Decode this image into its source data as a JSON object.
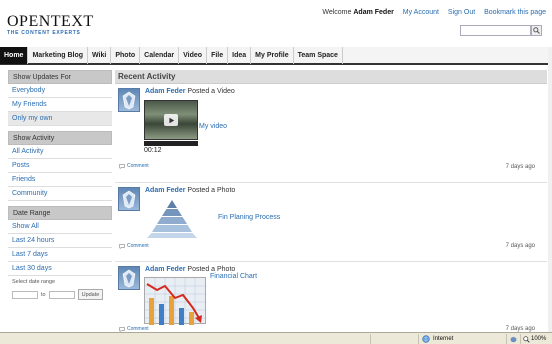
{
  "header": {
    "logo_name": "OPENTEXT",
    "logo_tagline": "THE CONTENT EXPERTS",
    "welcome_prefix": "Welcome",
    "user_name": "Adam Feder",
    "links": [
      "My Account",
      "Sign Out",
      "Bookmark this page"
    ]
  },
  "nav": {
    "tabs": [
      "Home",
      "Marketing Blog",
      "Wiki",
      "Photo",
      "Calendar",
      "Video",
      "File",
      "Idea",
      "My Profile",
      "Team Space"
    ],
    "active": "Home"
  },
  "sidebar": {
    "updates": {
      "title": "Show Updates For",
      "items": [
        "Everybody",
        "My Friends",
        "Only my own"
      ],
      "selected": "Only my own"
    },
    "activity": {
      "title": "Show Activity",
      "items": [
        "All Activity",
        "Posts",
        "Friends",
        "Community"
      ]
    },
    "daterange": {
      "title": "Date Range",
      "items": [
        "Show All",
        "Last 24 hours",
        "Last 7 days",
        "Last 30 days"
      ],
      "select_label": "Select date range",
      "to_label": "to",
      "update_label": "Update"
    }
  },
  "main": {
    "heading": "Recent Activity",
    "items": [
      {
        "actor": "Adam Feder",
        "action": "Posted a Video",
        "title": "My video",
        "duration": "00:12",
        "comment": "Comment",
        "ago": "7 days ago"
      },
      {
        "actor": "Adam Feder",
        "action": "Posted a Photo",
        "title": "Fin Planing Process",
        "comment": "Comment",
        "ago": "7 days ago"
      },
      {
        "actor": "Adam Feder",
        "action": "Posted a Photo",
        "title": "Financial Chart",
        "comment": "Comment",
        "ago": "7 days ago"
      }
    ]
  },
  "statusbar": {
    "zone": "Internet",
    "zoom": "100%"
  },
  "colors": {
    "link": "#2a6db0",
    "nav_active": "#111111",
    "panel_head": "#c8c8c8"
  }
}
